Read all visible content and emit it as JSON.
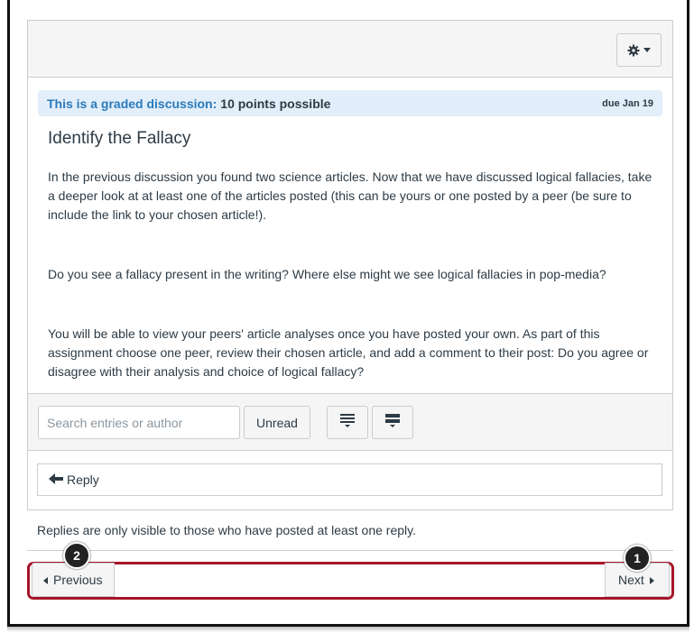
{
  "banner": {
    "graded_label": "This is a graded discussion:",
    "points": "10 points possible",
    "due": "due Jan 19"
  },
  "discussion": {
    "title": "Identify the Fallacy",
    "paragraphs": [
      "In the previous discussion you found two science articles.  Now that we have discussed logical fallacies, take a deeper look at at least one of the articles posted (this can be yours or one posted by a peer (be sure to include the link to your chosen article!).",
      "Do you see a fallacy present in the writing?  Where else might we see logical fallacies in pop-media?",
      "You will be able to view your peers' article analyses once you have posted your own.  As part of this assignment choose one peer, review their chosen article, and add a comment to their post:  Do you agree or disagree with their analysis and choice of logical fallacy?"
    ]
  },
  "toolbar": {
    "settings_icon": "gear-icon",
    "search_placeholder": "Search entries or author",
    "search_value": "",
    "unread_label": "Unread",
    "collapse_icon": "collapse-threads-icon",
    "expand_icon": "expand-threads-icon"
  },
  "reply": {
    "label": "Reply",
    "icon": "reply-arrow-icon"
  },
  "note": "Replies are only visible to those who have posted at least one reply.",
  "pager": {
    "previous_label": "Previous",
    "next_label": "Next"
  },
  "callouts": {
    "next_number": "1",
    "previous_number": "2"
  },
  "colors": {
    "accent_blue": "#2b7abc",
    "banner_bg": "#e2eef9",
    "highlight_red": "#a6152a",
    "panel_bg": "#f5f5f5"
  }
}
